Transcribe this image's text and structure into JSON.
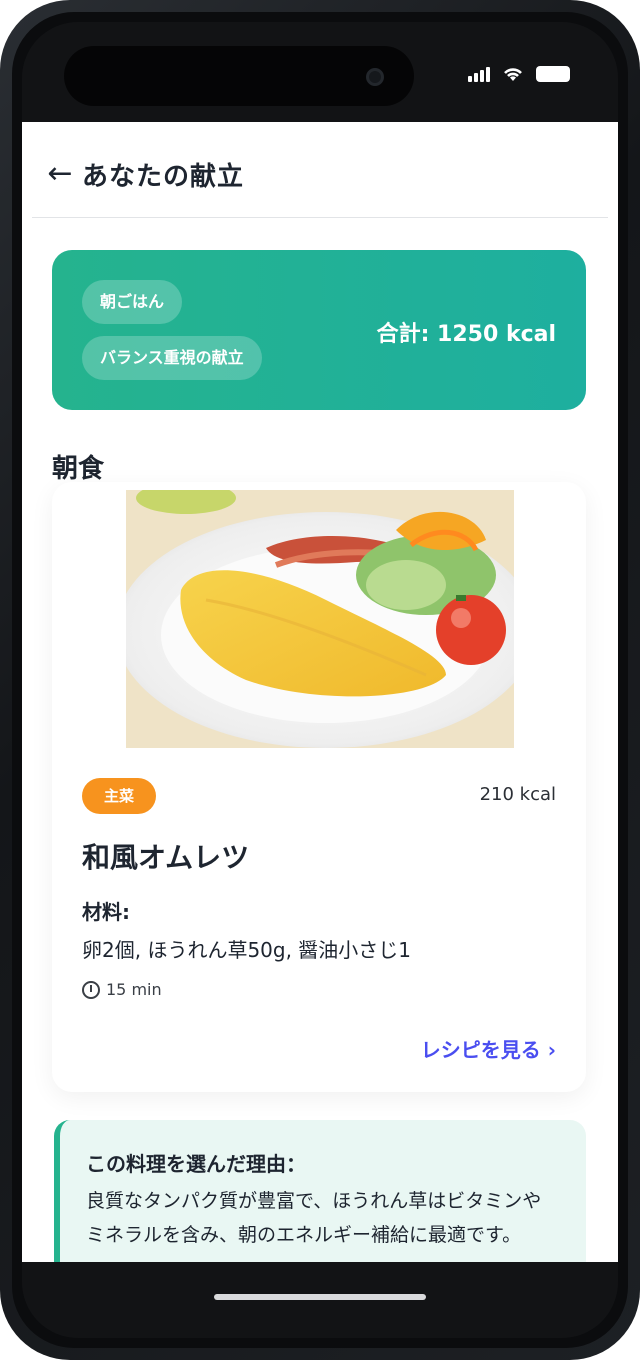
{
  "header": {
    "back_icon": "arrow-left-icon",
    "title": "あなたの献立"
  },
  "summary": {
    "pill_1": "朝ごはん",
    "pill_2": "バランス重視の献立",
    "total": "合計: 1250 kcal",
    "colors": {
      "from": "#25b38e",
      "to": "#1eaf9f"
    }
  },
  "section": {
    "title": "朝食"
  },
  "meal": {
    "badge": "主菜",
    "kcal": "210 kcal",
    "name": "和風オムレツ",
    "ingredients_label": "材料:",
    "ingredients": "卵2個, ほうれん草50g, 醤油小さじ1",
    "time": "15 min",
    "recipe_link": "レシピを見る ›",
    "badge_color": "#f7931e",
    "link_color": "#4a4ef0"
  },
  "reason": {
    "title": "この料理を選んだ理由：",
    "text": "良質なタンパク質が豊富で、ほうれん草はビタミンやミネラルを含み、朝のエネルギー補給に最適です。"
  }
}
